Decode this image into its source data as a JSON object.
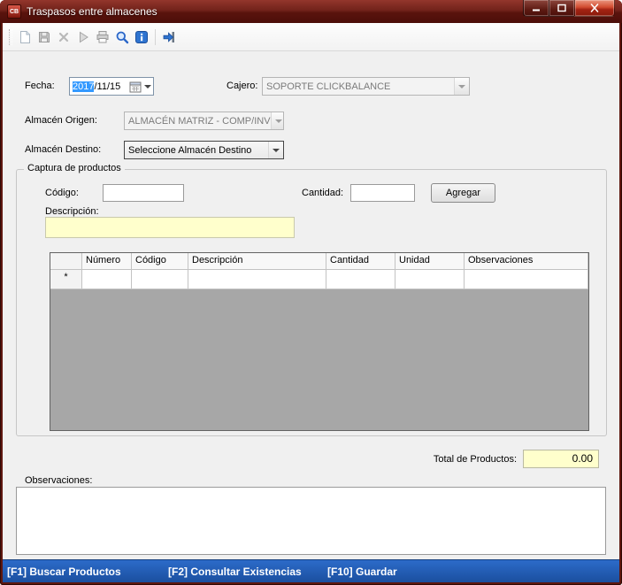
{
  "colors": {
    "titlebar_maroon": "#6f1f17",
    "statusbar_blue": "#1e56b4",
    "readonly_yellow": "#ffffcc",
    "selection_blue": "#3399ff",
    "grid_empty_gray": "#a7a7a7"
  },
  "window": {
    "title": "Traspasos entre almacenes",
    "icon_text": "CB"
  },
  "toolbar": {
    "icon_names": [
      "new-document",
      "save",
      "delete",
      "run",
      "print",
      "search",
      "info",
      "exit"
    ]
  },
  "form": {
    "fecha": {
      "label": "Fecha:",
      "year": "2017",
      "rest": "/11/15"
    },
    "cajero": {
      "label": "Cajero:",
      "value": "SOPORTE CLICKBALANCE"
    },
    "almacen_origen": {
      "label": "Almacén Origen:",
      "value": "ALMACÉN MATRIZ - COMP/INV"
    },
    "almacen_destino": {
      "label": "Almacén Destino:",
      "value": "Seleccione Almacén Destino"
    }
  },
  "captura": {
    "legend": "Captura de productos",
    "codigo_label": "Código:",
    "cantidad_label": "Cantidad:",
    "agregar_label": "Agregar",
    "descripcion_label": "Descripción:",
    "grid": {
      "columns": [
        "Número",
        "Código",
        "Descripción",
        "Cantidad",
        "Unidad",
        "Observaciones"
      ],
      "new_row_marker": "*",
      "rows": []
    }
  },
  "totals": {
    "label": "Total de Productos:",
    "value": "0.00"
  },
  "observaciones": {
    "label": "Observaciones:"
  },
  "statusbar": {
    "items": [
      "[F1] Buscar Productos",
      "[F2] Consultar Existencias",
      "[F10] Guardar"
    ]
  }
}
